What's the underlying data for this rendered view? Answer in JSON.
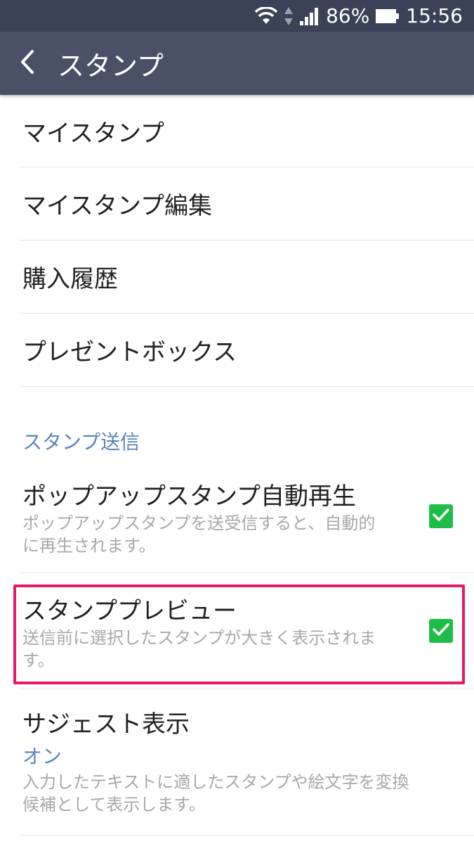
{
  "status_bar": {
    "battery_percent": "86%",
    "time": "15:56",
    "icons": [
      "wifi-icon",
      "data-arrows-icon",
      "signal-icon",
      "battery-icon"
    ]
  },
  "app_bar": {
    "title": "スタンプ",
    "back_icon": "chevron-left-icon"
  },
  "menu": {
    "items": [
      {
        "label": "マイスタンプ"
      },
      {
        "label": "マイスタンプ編集"
      },
      {
        "label": "購入履歴"
      },
      {
        "label": "プレゼントボックス"
      }
    ]
  },
  "section": {
    "header": "スタンプ送信"
  },
  "settings": {
    "popup_autoplay": {
      "title": "ポップアップスタンプ自動再生",
      "desc_line1": "ポップアップスタンプを送受信すると、自動的",
      "desc_line2": "に再生されます。",
      "checked": true
    },
    "preview": {
      "title": "スタンププレビュー",
      "desc_line1": "送信前に選択したスタンプが大きく表示されま",
      "desc_line2": "す。",
      "checked": true
    },
    "suggest": {
      "title": "サジェスト表示",
      "value": "オン",
      "desc_line1": "入力したテキストに適したスタンプや絵文字を変換",
      "desc_line2": "候補として表示します。"
    }
  },
  "colors": {
    "status_bar": "#3b4257",
    "app_bar": "#4a5167",
    "accent_blue": "#5a86b9",
    "checkbox_green": "#1fbd48",
    "highlight_pink": "#e8186b"
  }
}
